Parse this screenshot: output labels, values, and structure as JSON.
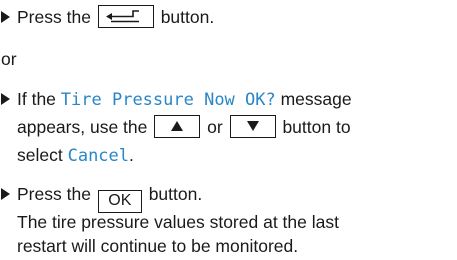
{
  "step1": {
    "before": "Press the",
    "after": "button.",
    "key_icon": "back-arrow-icon"
  },
  "or_label": "or",
  "step2": {
    "line1_before": "If the",
    "display_message": "Tire Pressure Now OK?",
    "line1_after": "message",
    "line2_before": "appears, use the",
    "up_key_icon": "triangle-up-icon",
    "or_word": "or",
    "down_key_icon": "triangle-down-icon",
    "line2_after": "button to",
    "line3_before": "select",
    "menu_option": "Cancel",
    "line3_after": "."
  },
  "step3": {
    "before": "Press the",
    "key_label": "OK",
    "after": "button.",
    "result_line1": "The tire pressure values stored at the last",
    "result_line2": "restart will continue to be monitored."
  },
  "colors": {
    "display_text": "#2a86c8",
    "body_text": "#1a1a1a"
  }
}
